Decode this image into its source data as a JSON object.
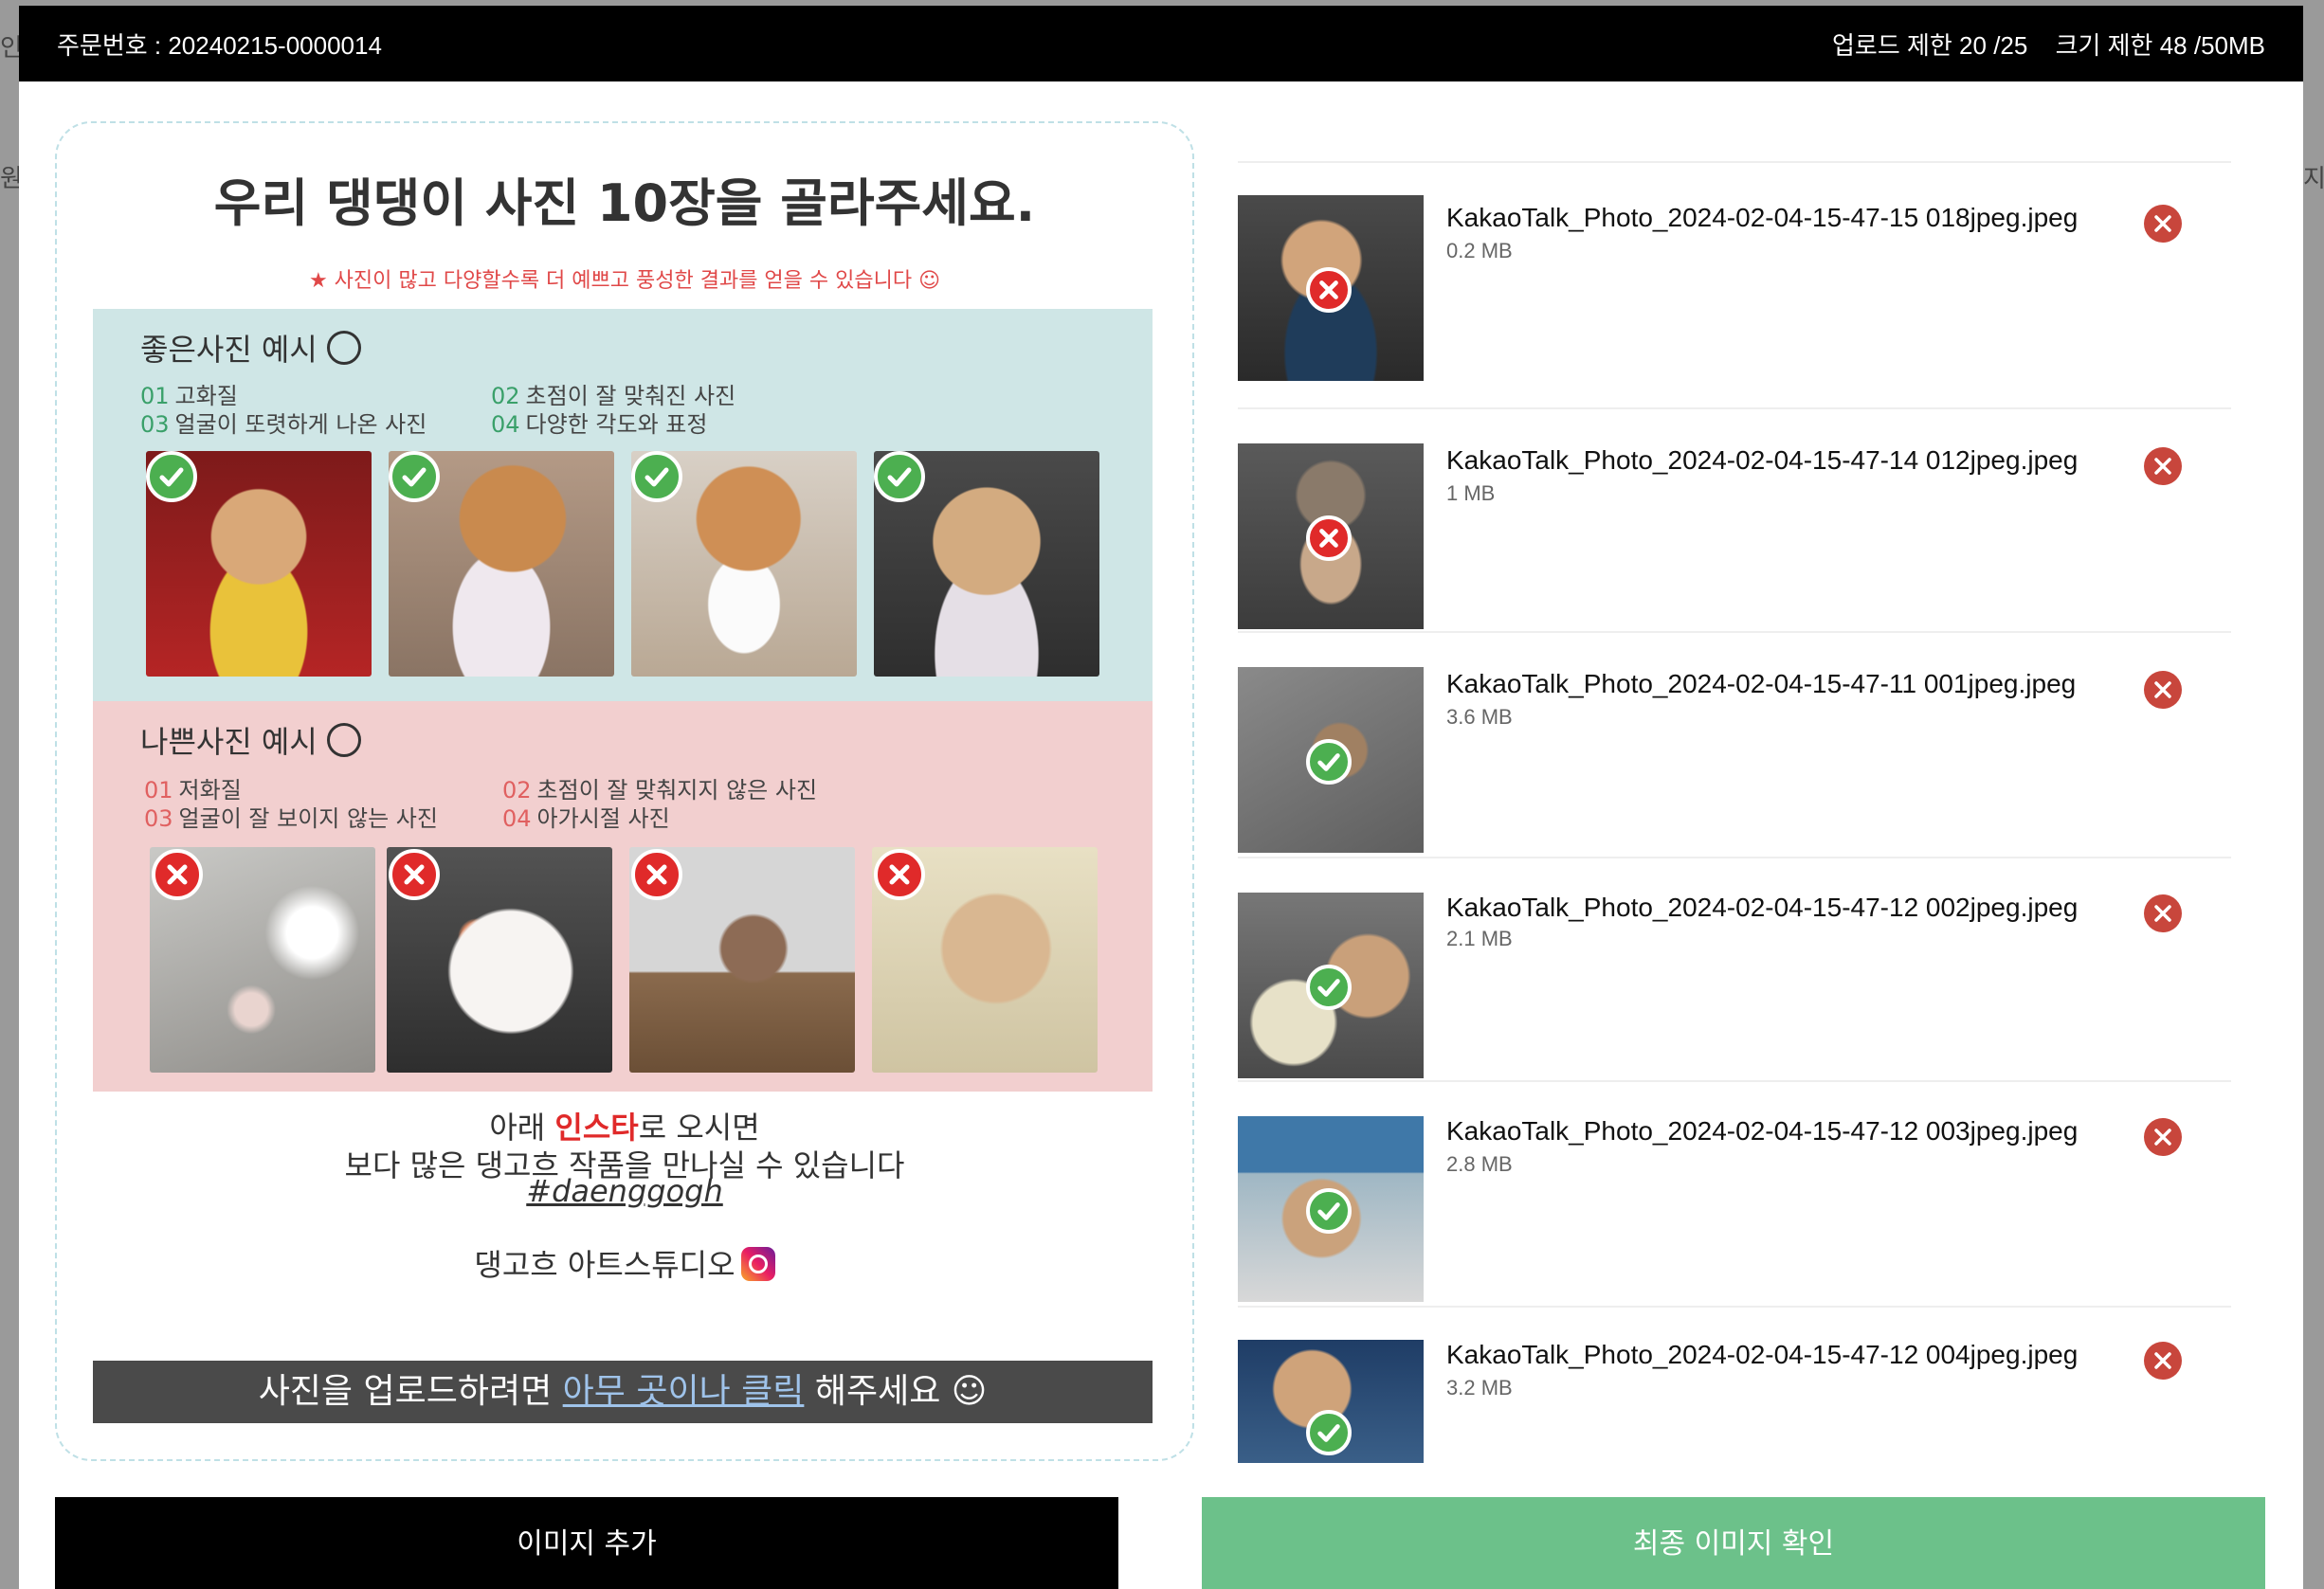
{
  "background": {
    "fragments": [
      "인",
      "원",
      "지"
    ]
  },
  "header": {
    "order_label": "주문번호 : 20240215-0000014",
    "upload_limit": "업로드 제한 20 /25",
    "size_limit": "크기 제한 48 /50MB"
  },
  "guide": {
    "title": "우리 댕댕이 사진 10장을 골라주세요.",
    "subtitle": "★ 사진이 많고 다양할수록 더 예쁘고 풍성한 결과를 얻을 수 있습니다 ☺",
    "good": {
      "title": "좋은사진 예시",
      "items": [
        {
          "num": "01",
          "text": "고화질"
        },
        {
          "num": "02",
          "text": "초점이 잘 맞춰진 사진"
        },
        {
          "num": "03",
          "text": "얼굴이 또렷하게 나온 사진"
        },
        {
          "num": "04",
          "text": "다양한 각도와 표정"
        }
      ]
    },
    "bad": {
      "title": "나쁜사진 예시",
      "items": [
        {
          "num": "01",
          "text": "저화질"
        },
        {
          "num": "02",
          "text": "초점이 잘 맞춰지지 않은 사진"
        },
        {
          "num": "03",
          "text": "얼굴이 잘 보이지 않는 사진"
        },
        {
          "num": "04",
          "text": "아가시절 사진"
        }
      ]
    },
    "insta_line1_a": "아래 ",
    "insta_line1_red": "인스타",
    "insta_line1_b": "로 오시면",
    "insta_line2": "보다 많은 댕고흐 작품을 만나실 수 있습니다",
    "hashtag": "#daenggogh",
    "studio": "댕고흐 아트스튜디오",
    "upload_a": "사진을 업로드하려면 ",
    "upload_link": "아무 곳이나 클릭",
    "upload_b": " 해주세요 ☺"
  },
  "files": [
    {
      "name": "KakaoTalk_Photo_2024-02-04-15-47-15 018jpeg.jpeg",
      "size": "0.2 MB",
      "status": "rejected"
    },
    {
      "name": "KakaoTalk_Photo_2024-02-04-15-47-14 012jpeg.jpeg",
      "size": "1 MB",
      "status": "rejected"
    },
    {
      "name": "KakaoTalk_Photo_2024-02-04-15-47-11 001jpeg.jpeg",
      "size": "3.6 MB",
      "status": "accepted"
    },
    {
      "name": "KakaoTalk_Photo_2024-02-04-15-47-12 002jpeg.jpeg",
      "size": "2.1 MB",
      "status": "accepted"
    },
    {
      "name": "KakaoTalk_Photo_2024-02-04-15-47-12 003jpeg.jpeg",
      "size": "2.8 MB",
      "status": "accepted"
    },
    {
      "name": "KakaoTalk_Photo_2024-02-04-15-47-12 004jpeg.jpeg",
      "size": "3.2 MB",
      "status": "accepted"
    }
  ],
  "buttons": {
    "add": "이미지 추가",
    "confirm": "최종 이미지 확인"
  },
  "colors": {
    "accept": "#4caf50",
    "reject": "#e02a2a",
    "confirm_button": "#6cc18a",
    "good_panel": "#cfe6e6",
    "bad_panel": "#f2cfcf"
  }
}
